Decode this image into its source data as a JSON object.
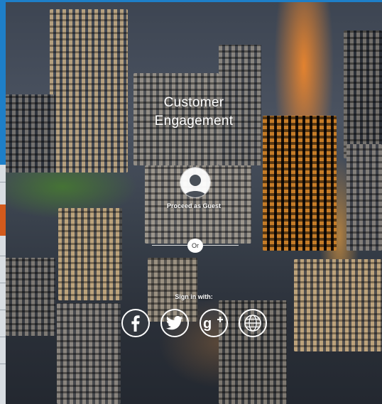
{
  "header": {
    "title_line1": "Customer",
    "title_line2": "Engagement"
  },
  "guest": {
    "label": "Proceed as Guest",
    "icon": "user-avatar-icon"
  },
  "divider": {
    "label": "Or"
  },
  "signin": {
    "label": "Sign in with:",
    "providers": [
      {
        "name": "Facebook",
        "icon": "facebook-icon"
      },
      {
        "name": "Twitter",
        "icon": "twitter-icon"
      },
      {
        "name": "Google+",
        "icon": "google-plus-icon"
      },
      {
        "name": "Web",
        "icon": "globe-icon"
      }
    ]
  },
  "colors": {
    "accent": "#1e7fc8",
    "overlay_text": "#ffffff",
    "side_orange": "#d35a1c"
  }
}
